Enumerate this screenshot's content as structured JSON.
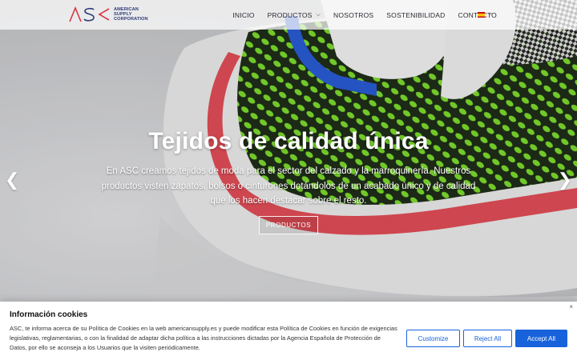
{
  "brand": {
    "logo_letters": "ASC",
    "logo_text_lines": [
      "AMERICAN",
      "SUPPLY",
      "CORPORATION"
    ],
    "colors": {
      "navy": "#2e3a78",
      "red": "#d8343f"
    }
  },
  "nav": {
    "items": [
      {
        "label": "INICIO",
        "has_dropdown": false
      },
      {
        "label": "PRODUCTOS",
        "has_dropdown": true
      },
      {
        "label": "NOSOTROS",
        "has_dropdown": false
      },
      {
        "label": "SOSTENIBILIDAD",
        "has_dropdown": false
      },
      {
        "label": "CONTACTO",
        "has_dropdown": false
      }
    ],
    "language_flag": "spain-flag-icon"
  },
  "hero": {
    "title": "Tejidos de calidad única",
    "text": "En ASC creamos tejidos de moda para el sector del calzado y la marroquinería. Nuestros productos visten zapatos, bolsos o cinturones dotándolos de un acabado único y de calidad que los hacen destacar sobre el resto.",
    "button_label": "PRODUCTOS",
    "prev_icon": "chevron-left-icon",
    "next_icon": "chevron-right-icon"
  },
  "cookies": {
    "title": "Información cookies",
    "text": "ASC, te informa acerca de su Política de Cookies en la web americansupply.es y puede modificar esta Política de Cookies en función de exigencias legislativas, reglamentarias, o con la finalidad de adaptar dicha política a las instrucciones dictadas por la Agencia Española de Protección de Datos, por ello se aconseja a los Usuarios que la visiten periódicamente.",
    "customize_label": "Customize",
    "reject_label": "Reject All",
    "accept_label": "Accept All",
    "close_symbol": "×",
    "accent_color": "#1863dc"
  }
}
